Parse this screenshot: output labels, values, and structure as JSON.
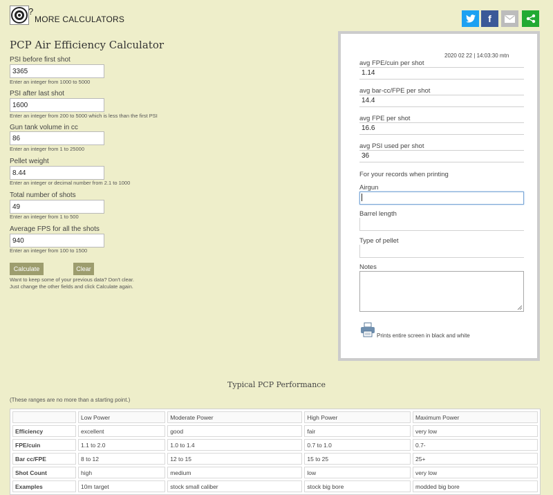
{
  "header": {
    "more_calculators": "MORE CALCULATORS",
    "share": [
      {
        "name": "twitter-icon",
        "color": "#1da1f2"
      },
      {
        "name": "facebook-icon",
        "color": "#3b5998"
      },
      {
        "name": "email-icon",
        "color": "#bcbcbc"
      },
      {
        "name": "share-icon",
        "color": "#22aa33"
      }
    ]
  },
  "form": {
    "title": "PCP Air Efficiency Calculator",
    "fields": [
      {
        "label": "PSI before first shot",
        "value": "3365",
        "hint": "Enter an integer from 1000 to 5000"
      },
      {
        "label": "PSI after last shot",
        "value": "1600",
        "hint": "Enter an integer from 200 to 5000 which is less than the first PSI"
      },
      {
        "label": "Gun tank volume in cc",
        "value": "86",
        "hint": "Enter an integer from 1 to 25000"
      },
      {
        "label": "Pellet weight",
        "value": "8.44",
        "hint": "Enter an integer or decimal number from 2.1 to 1000"
      },
      {
        "label": "Total number of shots",
        "value": "49",
        "hint": "Enter an integer from 1 to 500"
      },
      {
        "label": "Average FPS for all the shots",
        "value": "940",
        "hint": "Enter an integer from 100 to 1500"
      }
    ],
    "calculate_label": "Calculate",
    "clear_label": "Clear",
    "note_line1": "Want to keep some of your previous data? Don't clear.",
    "note_line2": "Just change the other fields and click Calculate again."
  },
  "results": {
    "timestamp": "2020 02 22 | 14:03:30 mtn",
    "items": [
      {
        "label": "avg FPE/cuin per shot",
        "value": "1.14"
      },
      {
        "label": "avg bar-cc/FPE per shot",
        "value": "14.4"
      },
      {
        "label": "avg FPE per shot",
        "value": "16.6"
      },
      {
        "label": "avg PSI used per shot",
        "value": "36"
      }
    ],
    "records_label": "For your records when printing",
    "airgun_label": "Airgun",
    "barrel_label": "Barrel length",
    "pellet_type_label": "Type of pellet",
    "notes_label": "Notes",
    "print_text": "Prints entire screen in black and white"
  },
  "performance": {
    "title": "Typical PCP Performance",
    "note": "(These ranges are no more than a starting point.)",
    "columns": [
      "",
      "Low Power",
      "Moderate Power",
      "High Power",
      "Maximum Power"
    ],
    "rows": [
      [
        "Efficiency",
        "excellent",
        "good",
        "fair",
        "very low"
      ],
      [
        "FPE/cuin",
        "1.1 to 2.0",
        "1.0 to 1.4",
        "0.7 to 1.0",
        "0.7-"
      ],
      [
        "Bar cc/FPE",
        "8 to 12",
        "12 to 15",
        "15 to 25",
        "25+"
      ],
      [
        "Shot Count",
        "high",
        "medium",
        "low",
        "very low"
      ],
      [
        "Examples",
        "10m target",
        "stock small caliber",
        "stock big bore",
        "modded big bore"
      ]
    ]
  }
}
